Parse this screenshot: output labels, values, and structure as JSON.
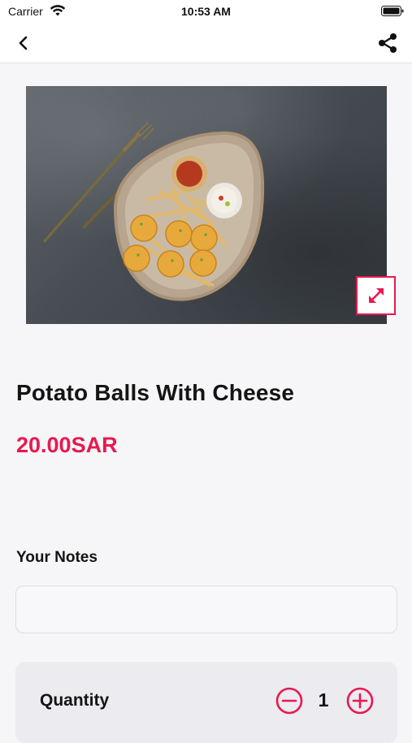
{
  "status_bar": {
    "carrier": "Carrier",
    "time": "10:53 AM",
    "wifi_icon": "wifi-icon",
    "battery_icon": "battery-icon"
  },
  "nav": {
    "back_icon": "chevron-left-icon",
    "share_icon": "share-icon"
  },
  "product": {
    "image_alt": "Potato Balls With Cheese plate",
    "expand_icon": "expand-arrows-icon",
    "name": "Potato Balls With Cheese",
    "price": "20.00SAR"
  },
  "notes": {
    "label": "Your Notes",
    "value": "",
    "placeholder": ""
  },
  "quantity": {
    "label": "Quantity",
    "value": "1",
    "minus_icon": "minus-circle-icon",
    "plus_icon": "plus-circle-icon"
  },
  "colors": {
    "accent": "#e8194f",
    "background": "#f6f6f8",
    "card": "#ebebf0",
    "text": "#141414"
  }
}
